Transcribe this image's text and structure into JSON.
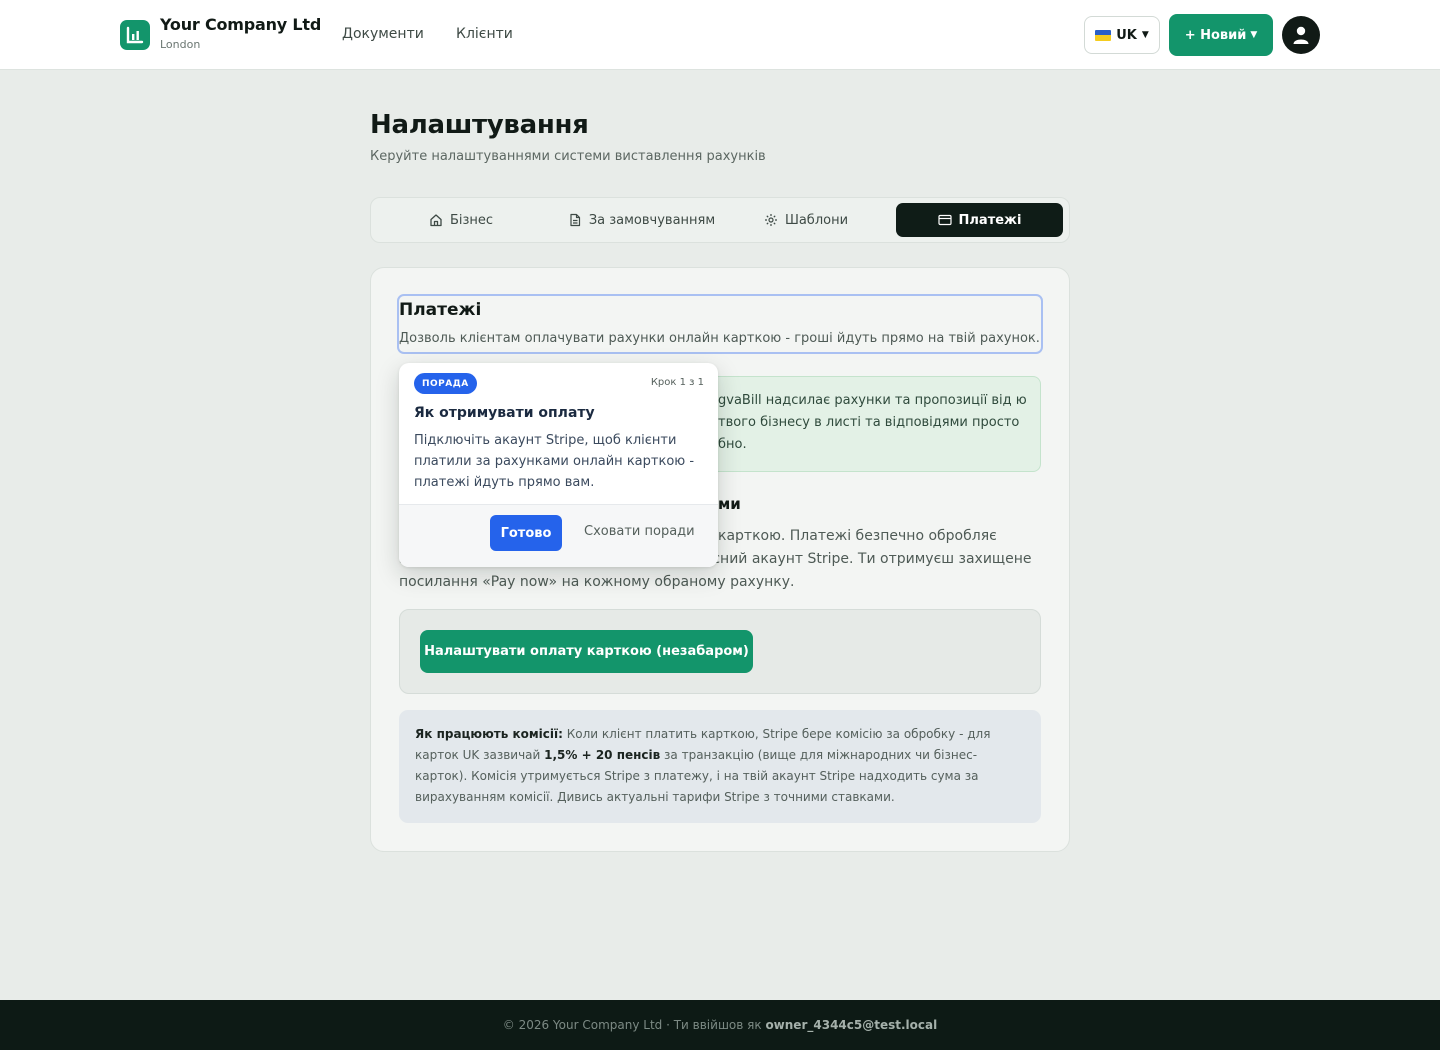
{
  "header": {
    "company_name": "Your Company Ltd",
    "company_city": "London",
    "nav": [
      "Документи",
      "Клієнти"
    ],
    "lang_label": "UK",
    "new_button_label": "+ Новий",
    "brand_color": "#13956b"
  },
  "page": {
    "title": "Налаштування",
    "subtitle": "Керуйте налаштуваннями системи виставлення рахунків"
  },
  "tabs": [
    {
      "label": "Бізнес",
      "icon": "home-icon",
      "active": false
    },
    {
      "label": "За замовчуванням",
      "icon": "document-icon",
      "active": false
    },
    {
      "label": "Шаблони",
      "icon": "gear-icon",
      "active": false
    },
    {
      "label": "Платежі",
      "icon": "credit-card-icon",
      "active": true
    }
  ],
  "payments": {
    "title": "Платежі",
    "description": "Дозволь клієнтам оплачувати рахунки онлайн карткою - гроші йдуть прямо на твій рахунок.",
    "info_fragment": "gvaBill надсилає рахунки та пропозиції від ю твого бізнесу в листі та відповідями просто бно.",
    "section_title_fragment": "ми",
    "body_text_fragment": "карткою. Платежі безпечно обробляє Stripe, і вони надходять прямо на твій власний акаунт Stripe. Ти отримуєш захищене посилання «Pay now» на кожному обраному рахунку.",
    "setup_button_label": "Налаштувати оплату карткою (незабаром)",
    "fees": {
      "label": "Як працюють комісії:",
      "text_1": " Коли клієнт платить карткою, Stripe бере комісію за обробку - для карток UK зазвичай ",
      "rate": "1,5% + 20 пенсів",
      "text_2": " за транзакцію (вище для міжнародних чи бізнес-карток). Комісія утримується Stripe з платежу, і на твій акаунт Stripe надходить сума за вирахуванням комісії. Дивись актуальні тарифи Stripe з точними ставками."
    }
  },
  "tip": {
    "badge": "ПОРАДА",
    "step": "Крок 1 з 1",
    "title": "Як отримувати оплату",
    "body": "Підключіть акаунт Stripe, щоб клієнти платили за рахунками онлайн карткою - платежі йдуть прямо вам.",
    "done_label": "Готово",
    "hide_label": "Сховати поради",
    "accent_color": "#2563eb"
  },
  "footer": {
    "text": "© 2026 Your Company Ltd · Ти ввійшов як ",
    "email": "owner_4344c5@test.local"
  }
}
